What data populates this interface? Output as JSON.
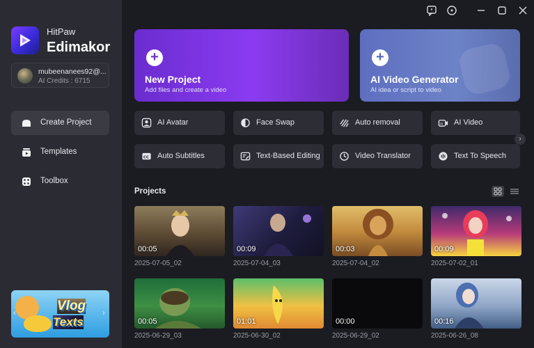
{
  "app": {
    "brand_top": "HitPaw",
    "brand_main": "Edimakor",
    "accent": "#7b3cff"
  },
  "account": {
    "email": "mubeenanees92@...",
    "credits": "AI Credits : 6715"
  },
  "sidebar": {
    "items": [
      {
        "label": "Create Project",
        "icon": "create-project-icon",
        "active": true
      },
      {
        "label": "Templates",
        "icon": "templates-icon",
        "active": false
      },
      {
        "label": "Toolbox",
        "icon": "toolbox-icon",
        "active": false
      }
    ],
    "promo": {
      "line1": "Vlog",
      "line2": "Texts"
    }
  },
  "hero": {
    "new_project": {
      "title": "New Project",
      "subtitle": "Add files and create a video"
    },
    "ai_video": {
      "title": "AI Video Generator",
      "subtitle": "AI idea or script to video"
    }
  },
  "tools": [
    {
      "label": "AI Avatar",
      "icon": "ai-avatar-icon"
    },
    {
      "label": "Face Swap",
      "icon": "face-swap-icon"
    },
    {
      "label": "Auto removal",
      "icon": "auto-removal-icon"
    },
    {
      "label": "AI Video",
      "icon": "ai-video-icon"
    },
    {
      "label": "Auto Subtitles",
      "icon": "cc-icon"
    },
    {
      "label": "Text-Based Editing",
      "icon": "text-edit-icon"
    },
    {
      "label": "Video Translator",
      "icon": "translate-icon"
    },
    {
      "label": "Text To Speech",
      "icon": "tts-icon"
    }
  ],
  "projects": {
    "title": "Projects",
    "items": [
      {
        "date": "2025-07-05_02",
        "duration": "00:05"
      },
      {
        "date": "2025-07-04_03",
        "duration": "00:09"
      },
      {
        "date": "2025-07-04_02",
        "duration": "00:03"
      },
      {
        "date": "2025-07-02_01",
        "duration": "00:09"
      },
      {
        "date": "2025-06-29_03",
        "duration": "00:05"
      },
      {
        "date": "2025-06-30_02",
        "duration": "01:01"
      },
      {
        "date": "2025-06-29_02",
        "duration": "00:00"
      },
      {
        "date": "2025-06-26_08",
        "duration": "00:16"
      }
    ]
  }
}
